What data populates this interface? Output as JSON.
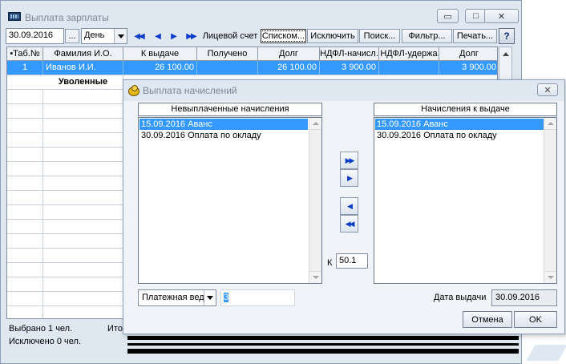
{
  "main_window": {
    "title": "Выплата зарплаты",
    "controls": {
      "minimize": "▭",
      "maximize": "□",
      "close": "✕"
    }
  },
  "toolbar": {
    "date_value": "30.09.2016",
    "date_picker_label": "...",
    "period_select": "День",
    "nav": {
      "first": "◀◀",
      "prev": "◀",
      "next": "▶",
      "last": "▶▶"
    },
    "account_label": "Лицевой счет",
    "list_label": "Списком...",
    "exclude_label": "Исключить",
    "search_label": "Поиск...",
    "filter_label": "Фильтр...",
    "print_label": "Печать...",
    "help_label": "?"
  },
  "grid": {
    "columns": [
      "•Таб.№",
      "Фамилия И.О.",
      "К выдаче",
      "Получено",
      "Долг",
      "НДФЛ-начисл.",
      "НДФЛ-удержа",
      "Долг"
    ],
    "rows": [
      {
        "tab": "1",
        "name": "Иванов И.И.",
        "to_pay": "26 100.00",
        "received": "",
        "debt": "26 100.00",
        "ndfl_accrued": "3 900.00",
        "ndfl_withheld": "",
        "debt2": "3 900.00"
      }
    ],
    "group_label": "Уволенные"
  },
  "status": {
    "selected": "Выбрано 1 чел.",
    "excluded": "Исключено 0 чел.",
    "total_label": "Ито"
  },
  "dialog": {
    "title": "Выплата начислений",
    "close": "✕",
    "left_list": {
      "header": "Невыплаченные начисления",
      "items": [
        "15.09.2016 Аванс",
        "30.09.2016 Оплата по окладу"
      ]
    },
    "right_list": {
      "header": "Начисления к выдаче",
      "items": [
        "15.09.2016 Аванс",
        "30.09.2016 Оплата по окладу"
      ]
    },
    "move_buttons": {
      "all_right": "▶▶",
      "one_right": "▶",
      "one_left": "◀",
      "all_left": "◀◀"
    },
    "k_label": "К",
    "k_value": "50.1",
    "doc_type": "Платежная вед",
    "doc_number": "3",
    "date_label": "Дата выдачи",
    "date_value": "30.09.2016",
    "cancel_label": "Отмена",
    "ok_label": "OK"
  }
}
